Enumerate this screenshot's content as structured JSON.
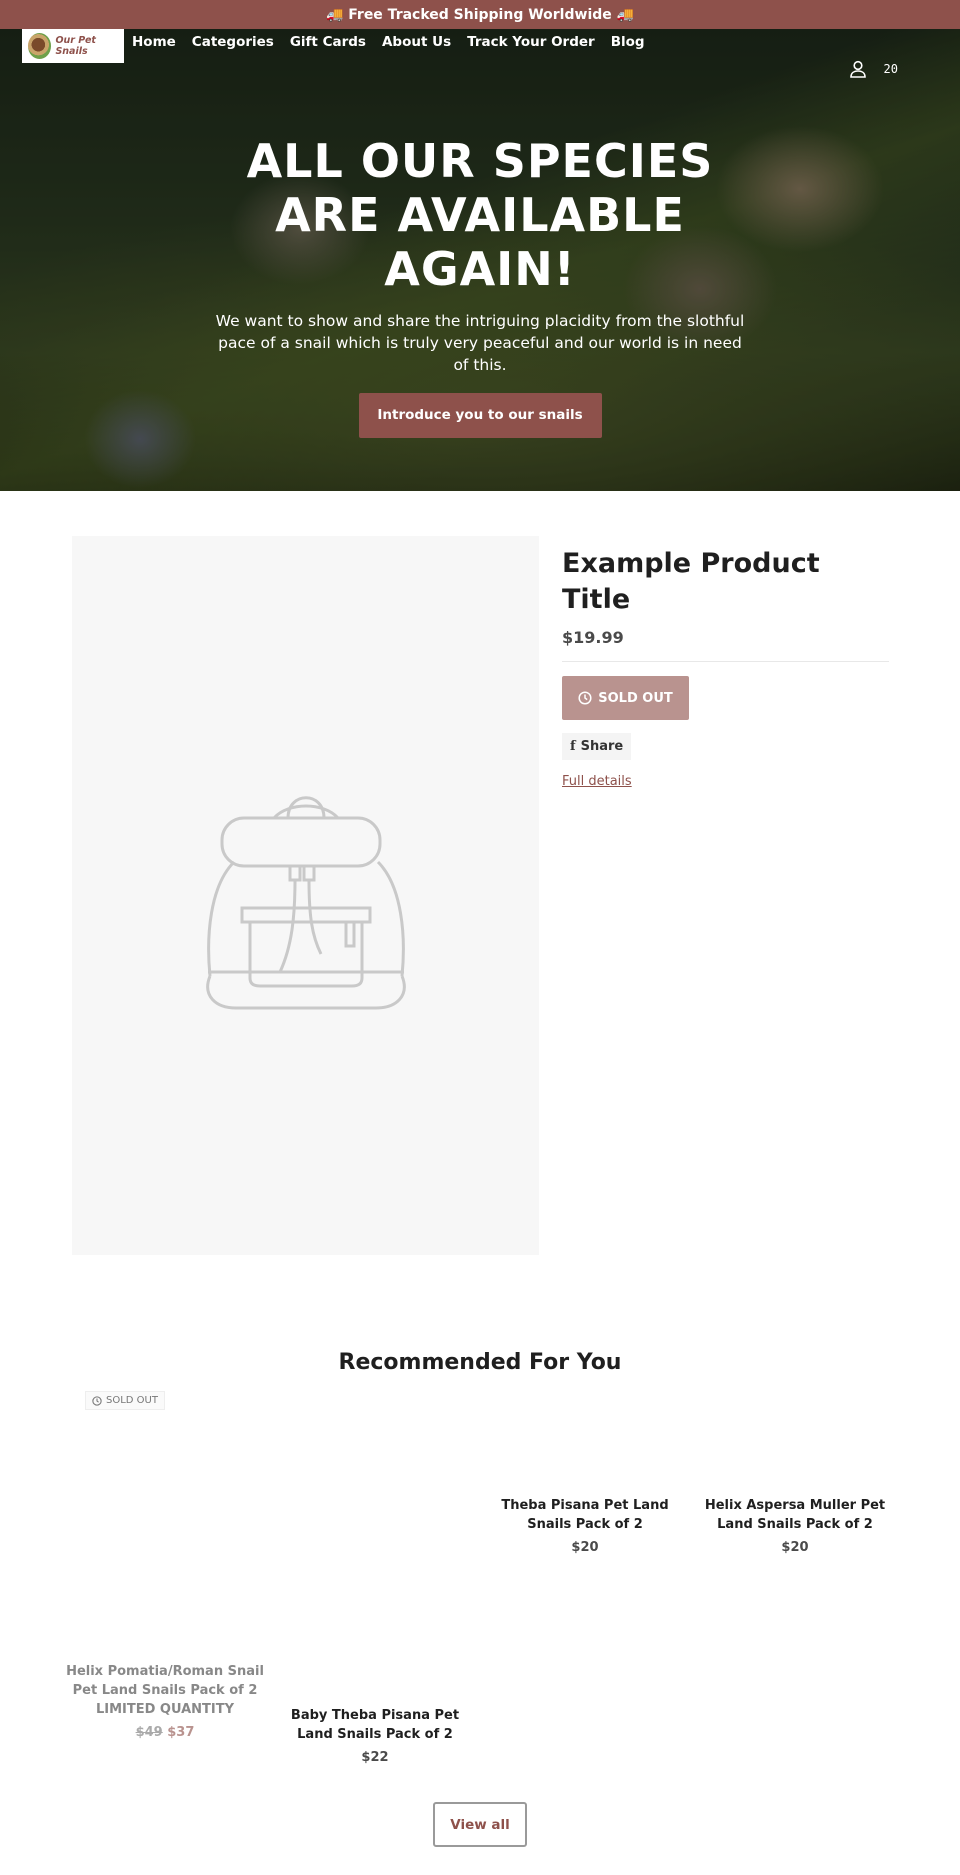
{
  "announcement": "🚚 Free Tracked Shipping Worldwide 🚚",
  "logo": {
    "text": "Our Pet Snails"
  },
  "nav": [
    "Home",
    "Categories",
    "Gift Cards",
    "About Us",
    "Track Your Order",
    "Blog"
  ],
  "cart": {
    "count": "20"
  },
  "hero": {
    "title": "ALL OUR SPECIES ARE AVAILABLE AGAIN!",
    "text": "We want to show and share the intriguing placidity from the slothful pace of a snail which is truly very peaceful and our world is in need of this.",
    "button": "Introduce you to our snails"
  },
  "product": {
    "title": "Example Product Title",
    "price": "$19.99",
    "sold_out": "SOLD OUT",
    "share": "Share",
    "full_details": "Full details"
  },
  "recommended": {
    "title": "Recommended For You",
    "badge": "SOLD OUT",
    "items": [
      {
        "title": "Helix Pomatia/Roman Snail Pet Land Snails Pack of 2 LIMITED QUANTITY",
        "old_price": "$49",
        "price": "$37"
      },
      {
        "title": "Baby Theba Pisana Pet Land Snails Pack of 2",
        "price": "$22"
      },
      {
        "title": "Theba Pisana Pet Land Snails Pack of 2",
        "price": "$20"
      },
      {
        "title": "Helix Aspersa Muller Pet Land Snails Pack of 2",
        "price": "$20"
      }
    ],
    "view_all": "View all"
  },
  "colors": {
    "brand": "#8e514b",
    "sold_out": "#b9938f"
  }
}
